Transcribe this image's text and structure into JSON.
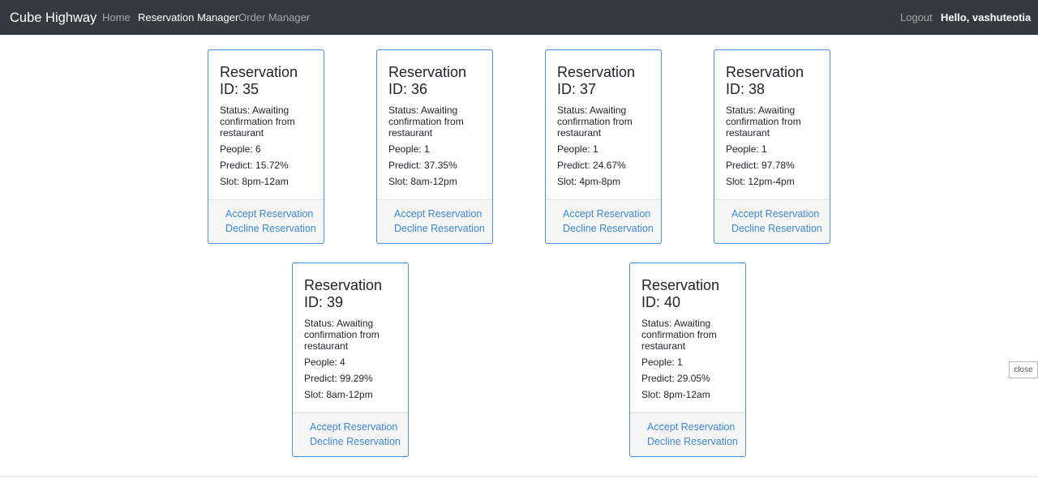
{
  "navbar": {
    "brand": "Cube Highway",
    "links": [
      {
        "label": "Home"
      },
      {
        "label": "Reservation Manager"
      },
      {
        "label": "Order Manager"
      }
    ],
    "logout": "Logout",
    "greeting": "Hello, vashuteotia"
  },
  "reservations": [
    {
      "title": "Reservation ID: 35",
      "status": "Status: Awaiting confirmation from restaurant",
      "people": "People: 6",
      "predict": "Predict: 15.72%",
      "slot": "Slot: 8pm-12am",
      "accept": "Accept Reservation",
      "decline": "Decline Reservation"
    },
    {
      "title": "Reservation ID: 36",
      "status": "Status: Awaiting confirmation from restaurant",
      "people": "People: 1",
      "predict": "Predict: 37.35%",
      "slot": "Slot: 8am-12pm",
      "accept": "Accept Reservation",
      "decline": "Decline Reservation"
    },
    {
      "title": "Reservation ID: 37",
      "status": "Status: Awaiting confirmation from restaurant",
      "people": "People: 1",
      "predict": "Predict: 24.67%",
      "slot": "Slot: 4pm-8pm",
      "accept": "Accept Reservation",
      "decline": "Decline Reservation"
    },
    {
      "title": "Reservation ID: 38",
      "status": "Status: Awaiting confirmation from restaurant",
      "people": "People: 1",
      "predict": "Predict: 97.78%",
      "slot": "Slot: 12pm-4pm",
      "accept": "Accept Reservation",
      "decline": "Decline Reservation"
    },
    {
      "title": "Reservation ID: 39",
      "status": "Status: Awaiting confirmation from restaurant",
      "people": "People: 4",
      "predict": "Predict: 99.29%",
      "slot": "Slot: 8am-12pm",
      "accept": "Accept Reservation",
      "decline": "Decline Reservation"
    },
    {
      "title": "Reservation ID: 40",
      "status": "Status: Awaiting confirmation from restaurant",
      "people": "People: 1",
      "predict": "Predict: 29.05%",
      "slot": "Slot: 8pm-12am",
      "accept": "Accept Reservation",
      "decline": "Decline Reservation"
    }
  ],
  "close_button": "close"
}
